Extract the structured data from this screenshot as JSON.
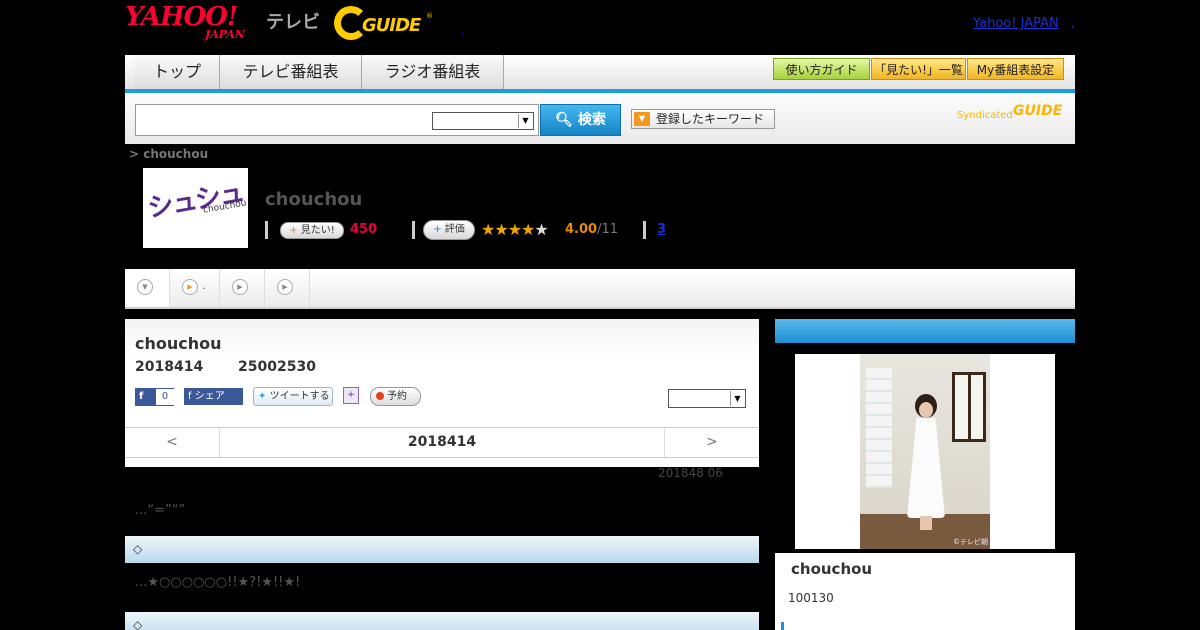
{
  "header": {
    "yahoo_logo_top": "YAHOO!",
    "yahoo_logo_bottom": "JAPAN",
    "tv_label": "テレビ",
    "gguide_logo": "GUIDE",
    "gguide_reg": "®",
    "dot_link": ",",
    "yahoo_japan_link": "Yahoo! JAPAN",
    "yahoo_japan_dot": ","
  },
  "nav": {
    "tabs": [
      {
        "label": "トップ"
      },
      {
        "label": "テレビ番組表"
      },
      {
        "label": "ラジオ番組表"
      }
    ],
    "right_buttons": [
      {
        "label": "使い方ガイド"
      },
      {
        "label": "「見たい!」一覧"
      },
      {
        "label": "My番組表設定"
      }
    ]
  },
  "search": {
    "input_value": "",
    "select_value": "",
    "search_button": "検索",
    "keyword_button": "登録したキーワード",
    "syndicated_label": "Syndicated",
    "syndicated_logo": "GUIDE"
  },
  "breadcrumb": "> chouchou",
  "program": {
    "thumb_text": "シュシュ",
    "thumb_sub": "chouchou",
    "title": "chouchou",
    "mitai_label": "見たい!",
    "mitai_count": "450",
    "hyoka_label": "評価",
    "stars_on": "★★★★",
    "stars_off": "★",
    "rating": "4.00",
    "rating_count": "/11",
    "review_link": "3"
  },
  "subnav": {
    "tabs": [
      {
        "icon": "▼",
        "label": ""
      },
      {
        "icon": "▶",
        "label": "."
      },
      {
        "icon": "▶",
        "label": ""
      },
      {
        "icon": "▶",
        "label": ""
      }
    ]
  },
  "episode": {
    "title": "chouchou",
    "date": "2018414",
    "time": "25002530",
    "fb_label": "f",
    "fb_count": "0",
    "share_label": "f シェア",
    "tweet_label": "ツイートする",
    "reserve_label": "予約",
    "select_value": "",
    "pager_prev": "<",
    "pager_current": "2018414",
    "pager_next": ">"
  },
  "content": {
    "updated": "201848  06",
    "desc1": "...“=”“”",
    "section1": "◇",
    "desc2": "...★○○○○○○!!★?!★!!★!",
    "section2": "◇"
  },
  "side": {
    "photo_credit": "©テレビ朝",
    "title": "chouchou",
    "number": "100130"
  },
  "colors": {
    "accent_blue": "#1e9ce0",
    "count_red": "#e60044",
    "rating_orange": "#e88a00",
    "logo_red": "#ff0033",
    "gguide_yellow": "#ffcc00"
  }
}
